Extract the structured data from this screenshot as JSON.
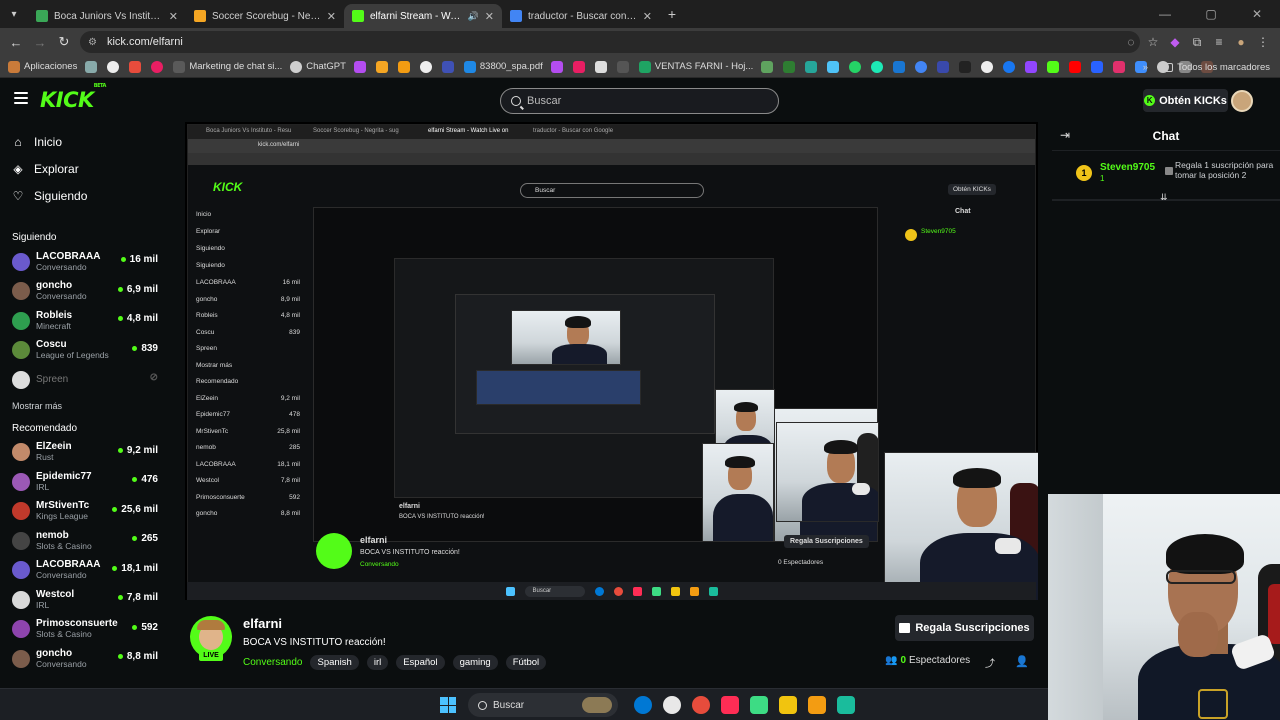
{
  "browser": {
    "tabs": [
      {
        "title": "Boca Juniors Vs Instituto - Resu",
        "favicon_color": "#3aa757",
        "active": false
      },
      {
        "title": "Soccer Scorebug - Negrita - sug",
        "favicon_color": "#f5a623",
        "active": false
      },
      {
        "title": "elfarni Stream - Watch Live",
        "favicon_color": "#53fc18",
        "active": true
      },
      {
        "title": "traductor - Buscar con Google",
        "favicon_color": "#4285f4",
        "active": false
      }
    ],
    "url": "kick.com/elfarni",
    "bookmarks_apps": "Aplicaciones",
    "bookmarks": [
      {
        "label": "Marketing de chat si...",
        "color": "#5a5a5a"
      },
      {
        "label": "ChatGPT",
        "color": "#cfcfcf"
      },
      {
        "label": "83800_spa.pdf",
        "color": "#1e88e5"
      },
      {
        "label": "VENTAS FARNI - Hoj...",
        "color": "#1fa463"
      }
    ],
    "bookmarks_all": "Todos los marcadores"
  },
  "kick": {
    "logo": "KICK",
    "logo_sup": "BETA",
    "search_placeholder": "Buscar",
    "get_kicks": "Obtén KICKs",
    "nav": [
      {
        "label": "Inicio",
        "icon": "home-icon"
      },
      {
        "label": "Explorar",
        "icon": "compass-icon"
      },
      {
        "label": "Siguiendo",
        "icon": "heart-icon"
      }
    ],
    "following_title": "Siguiendo",
    "following": [
      {
        "name": "LACOBRAAA",
        "game": "Conversando",
        "viewers": "16 mil",
        "color": "#6a5acd"
      },
      {
        "name": "goncho",
        "game": "Conversando",
        "viewers": "6,9 mil",
        "color": "#7b5c4b"
      },
      {
        "name": "Robleis",
        "game": "Minecraft",
        "viewers": "4,8 mil",
        "color": "#2e9e4f"
      },
      {
        "name": "Coscu",
        "game": "League of Legends",
        "viewers": "839",
        "color": "#5c8a3a"
      },
      {
        "name": "Spreen",
        "game": "",
        "viewers": "",
        "color": "#dddddd",
        "offline": true
      }
    ],
    "show_more": "Mostrar más",
    "recommended_title": "Recomendado",
    "recommended": [
      {
        "name": "ElZeein",
        "game": "Rust",
        "viewers": "9,2 mil",
        "color": "#c28a6a"
      },
      {
        "name": "Epidemic77",
        "game": "IRL",
        "viewers": "476",
        "color": "#9b59b6"
      },
      {
        "name": "MrStivenTc",
        "game": "Kings League",
        "viewers": "25,6 mil",
        "color": "#c0392b"
      },
      {
        "name": "nemob",
        "game": "Slots & Casino",
        "viewers": "265",
        "color": "#444444"
      },
      {
        "name": "LACOBRAAA",
        "game": "Conversando",
        "viewers": "18,1 mil",
        "color": "#6a5acd"
      },
      {
        "name": "Westcol",
        "game": "IRL",
        "viewers": "7,8 mil",
        "color": "#d9d9d9"
      },
      {
        "name": "Primosconsuerte",
        "game": "Slots & Casino",
        "viewers": "592",
        "color": "#8e44ad"
      },
      {
        "name": "goncho",
        "game": "Conversando",
        "viewers": "8,8 mil",
        "color": "#7b5c4b"
      }
    ],
    "stream": {
      "streamer": "elfarni",
      "title": "BOCA VS INSTITUTO reacción!",
      "category": "Conversando",
      "tags": [
        "Spanish",
        "irl",
        "Español",
        "gaming",
        "Fútbol"
      ],
      "live": "LIVE",
      "gift_subs": "Regala Suscripciones",
      "viewers": "0",
      "viewers_label": "Espectadores"
    },
    "chat": {
      "title": "Chat",
      "pinned_rank": "1",
      "pinned_user": "Steven9705",
      "pinned_sub": "1",
      "pinned_message": "Regala 1 suscripción para tomar la posición 2"
    }
  },
  "taskbar": {
    "search": "Buscar",
    "apps": [
      "#0078d4",
      "#e8e8e8",
      "#e74c3c",
      "#ff2d55",
      "#3ddc84",
      "#f1c40f",
      "#f39c12",
      "#1abc9c"
    ]
  },
  "nested_capture": {
    "tabs": [
      "Boca Juniors Vs Instituto - Resu",
      "Soccer Scorebug - Negrita - sug",
      "elfarni Stream - Watch Live on",
      "traductor - Buscar con Google"
    ],
    "url": "kick.com/elfarni",
    "streamer": "elfarni",
    "title": "BOCA VS INSTITUTO reacción!",
    "gift_subs": "Regala Suscripciones",
    "viewers": "0 Espectadores",
    "chat_title": "Chat",
    "search": "Buscar",
    "get_kicks": "Obtén KICKs",
    "sidebar": [
      [
        "Inicio",
        ""
      ],
      [
        "Explorar",
        ""
      ],
      [
        "Siguiendo",
        ""
      ],
      [
        "Siguiendo",
        ""
      ],
      [
        "LACOBRAAA",
        "16 mil"
      ],
      [
        "goncho",
        "8,9 mil"
      ],
      [
        "Robleis",
        "4,8 mil"
      ],
      [
        "Coscu",
        "839"
      ],
      [
        "Spreen",
        ""
      ],
      [
        "Mostrar más",
        ""
      ],
      [
        "Recomendado",
        ""
      ],
      [
        "ElZeein",
        "9,2 mil"
      ],
      [
        "Epidemic77",
        "478"
      ],
      [
        "MrStivenTc",
        "25,8 mil"
      ],
      [
        "nemob",
        "285"
      ],
      [
        "LACOBRAAA",
        "18,1 mil"
      ],
      [
        "Westcol",
        "7,8 mil"
      ],
      [
        "Primosconsuerte",
        "592"
      ],
      [
        "goncho",
        "8,8 mil"
      ]
    ]
  }
}
